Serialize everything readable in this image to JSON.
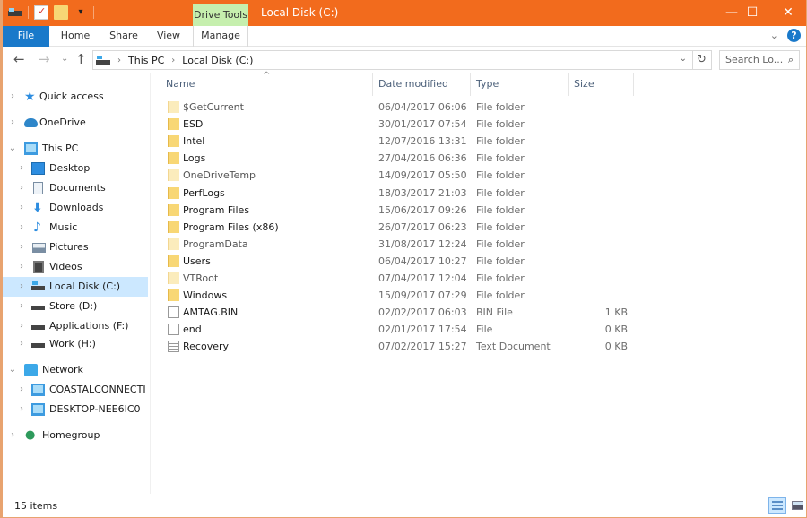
{
  "titlebar": {
    "title": "Local Disk (C:)",
    "context_tab": "Drive Tools",
    "qat_icons": [
      "drive-icon",
      "properties-icon",
      "new-folder-icon",
      "customize-dropdown-icon"
    ],
    "minimize": "—",
    "maximize": "☐",
    "close": "✕",
    "accent": "#f26b1d"
  },
  "ribbon": {
    "tabs": [
      {
        "label": "File"
      },
      {
        "label": "Home"
      },
      {
        "label": "Share"
      },
      {
        "label": "View"
      },
      {
        "label": "Manage"
      }
    ],
    "expand": "⌄",
    "help": "?"
  },
  "nav": {
    "back": "←",
    "forward": "→",
    "recent": "⌄",
    "up": "↑",
    "breadcrumb": [
      "This PC",
      "Local Disk (C:)"
    ],
    "separator": "›",
    "refresh": "↻",
    "search_placeholder": "Search Lo...",
    "search_icon": "⌕"
  },
  "sidebar": {
    "items": [
      {
        "label": "Quick access",
        "arrow": "›",
        "icon": "star"
      },
      {
        "label": "OneDrive",
        "arrow": "›",
        "icon": "cloud"
      },
      {
        "label": "This PC",
        "arrow": "⌄",
        "icon": "pc"
      },
      {
        "label": "Desktop",
        "arrow": "›",
        "icon": "desktop"
      },
      {
        "label": "Documents",
        "arrow": "›",
        "icon": "documents"
      },
      {
        "label": "Downloads",
        "arrow": "›",
        "icon": "downloads"
      },
      {
        "label": "Music",
        "arrow": "›",
        "icon": "music"
      },
      {
        "label": "Pictures",
        "arrow": "›",
        "icon": "pictures"
      },
      {
        "label": "Videos",
        "arrow": "›",
        "icon": "videos"
      },
      {
        "label": "Local Disk (C:)",
        "arrow": "›",
        "icon": "disk",
        "selected": true
      },
      {
        "label": "Store (D:)",
        "arrow": "›",
        "icon": "disk"
      },
      {
        "label": "Applications (F:)",
        "arrow": "›",
        "icon": "disk"
      },
      {
        "label": "Work (H:)",
        "arrow": "›",
        "icon": "disk"
      },
      {
        "label": "Network",
        "arrow": "⌄",
        "icon": "network"
      },
      {
        "label": "COASTALCONNECTI",
        "arrow": "›",
        "icon": "computer"
      },
      {
        "label": "DESKTOP-NEE6IC0",
        "arrow": "›",
        "icon": "computer"
      },
      {
        "label": "Homegroup",
        "arrow": "›",
        "icon": "homegroup"
      }
    ],
    "icons": {
      "star": "★",
      "downloads": "⬇",
      "music": "♪",
      "homegroup": "●"
    }
  },
  "files": {
    "columns": [
      "Name",
      "Date modified",
      "Type",
      "Size"
    ],
    "sort_indicator": "^",
    "rows": [
      {
        "name": "$GetCurrent",
        "date": "06/04/2017 06:06",
        "type": "File folder",
        "size": "",
        "kind": "folder",
        "hidden": true
      },
      {
        "name": "ESD",
        "date": "30/01/2017 07:54",
        "type": "File folder",
        "size": "",
        "kind": "folder",
        "hidden": false
      },
      {
        "name": "Intel",
        "date": "12/07/2016 13:31",
        "type": "File folder",
        "size": "",
        "kind": "folder",
        "hidden": false
      },
      {
        "name": "Logs",
        "date": "27/04/2016 06:36",
        "type": "File folder",
        "size": "",
        "kind": "folder",
        "hidden": false
      },
      {
        "name": "OneDriveTemp",
        "date": "14/09/2017 05:50",
        "type": "File folder",
        "size": "",
        "kind": "folder",
        "hidden": true
      },
      {
        "name": "PerfLogs",
        "date": "18/03/2017 21:03",
        "type": "File folder",
        "size": "",
        "kind": "folder",
        "hidden": false
      },
      {
        "name": "Program Files",
        "date": "15/06/2017 09:26",
        "type": "File folder",
        "size": "",
        "kind": "folder",
        "hidden": false
      },
      {
        "name": "Program Files (x86)",
        "date": "26/07/2017 06:23",
        "type": "File folder",
        "size": "",
        "kind": "folder",
        "hidden": false
      },
      {
        "name": "ProgramData",
        "date": "31/08/2017 12:24",
        "type": "File folder",
        "size": "",
        "kind": "folder",
        "hidden": true
      },
      {
        "name": "Users",
        "date": "06/04/2017 10:27",
        "type": "File folder",
        "size": "",
        "kind": "folder",
        "hidden": false
      },
      {
        "name": "VTRoot",
        "date": "07/04/2017 12:04",
        "type": "File folder",
        "size": "",
        "kind": "folder",
        "hidden": true
      },
      {
        "name": "Windows",
        "date": "15/09/2017 07:29",
        "type": "File folder",
        "size": "",
        "kind": "folder",
        "hidden": false
      },
      {
        "name": "AMTAG.BIN",
        "date": "02/02/2017 06:03",
        "type": "BIN File",
        "size": "1 KB",
        "kind": "file",
        "hidden": false
      },
      {
        "name": "end",
        "date": "02/01/2017 17:54",
        "type": "File",
        "size": "0 KB",
        "kind": "file",
        "hidden": false
      },
      {
        "name": "Recovery",
        "date": "07/02/2017 15:27",
        "type": "Text Document",
        "size": "0 KB",
        "kind": "txt",
        "hidden": false
      }
    ]
  },
  "status": {
    "item_count": "15 items",
    "view_details_label": "Details view",
    "view_large_label": "Large icons view"
  }
}
